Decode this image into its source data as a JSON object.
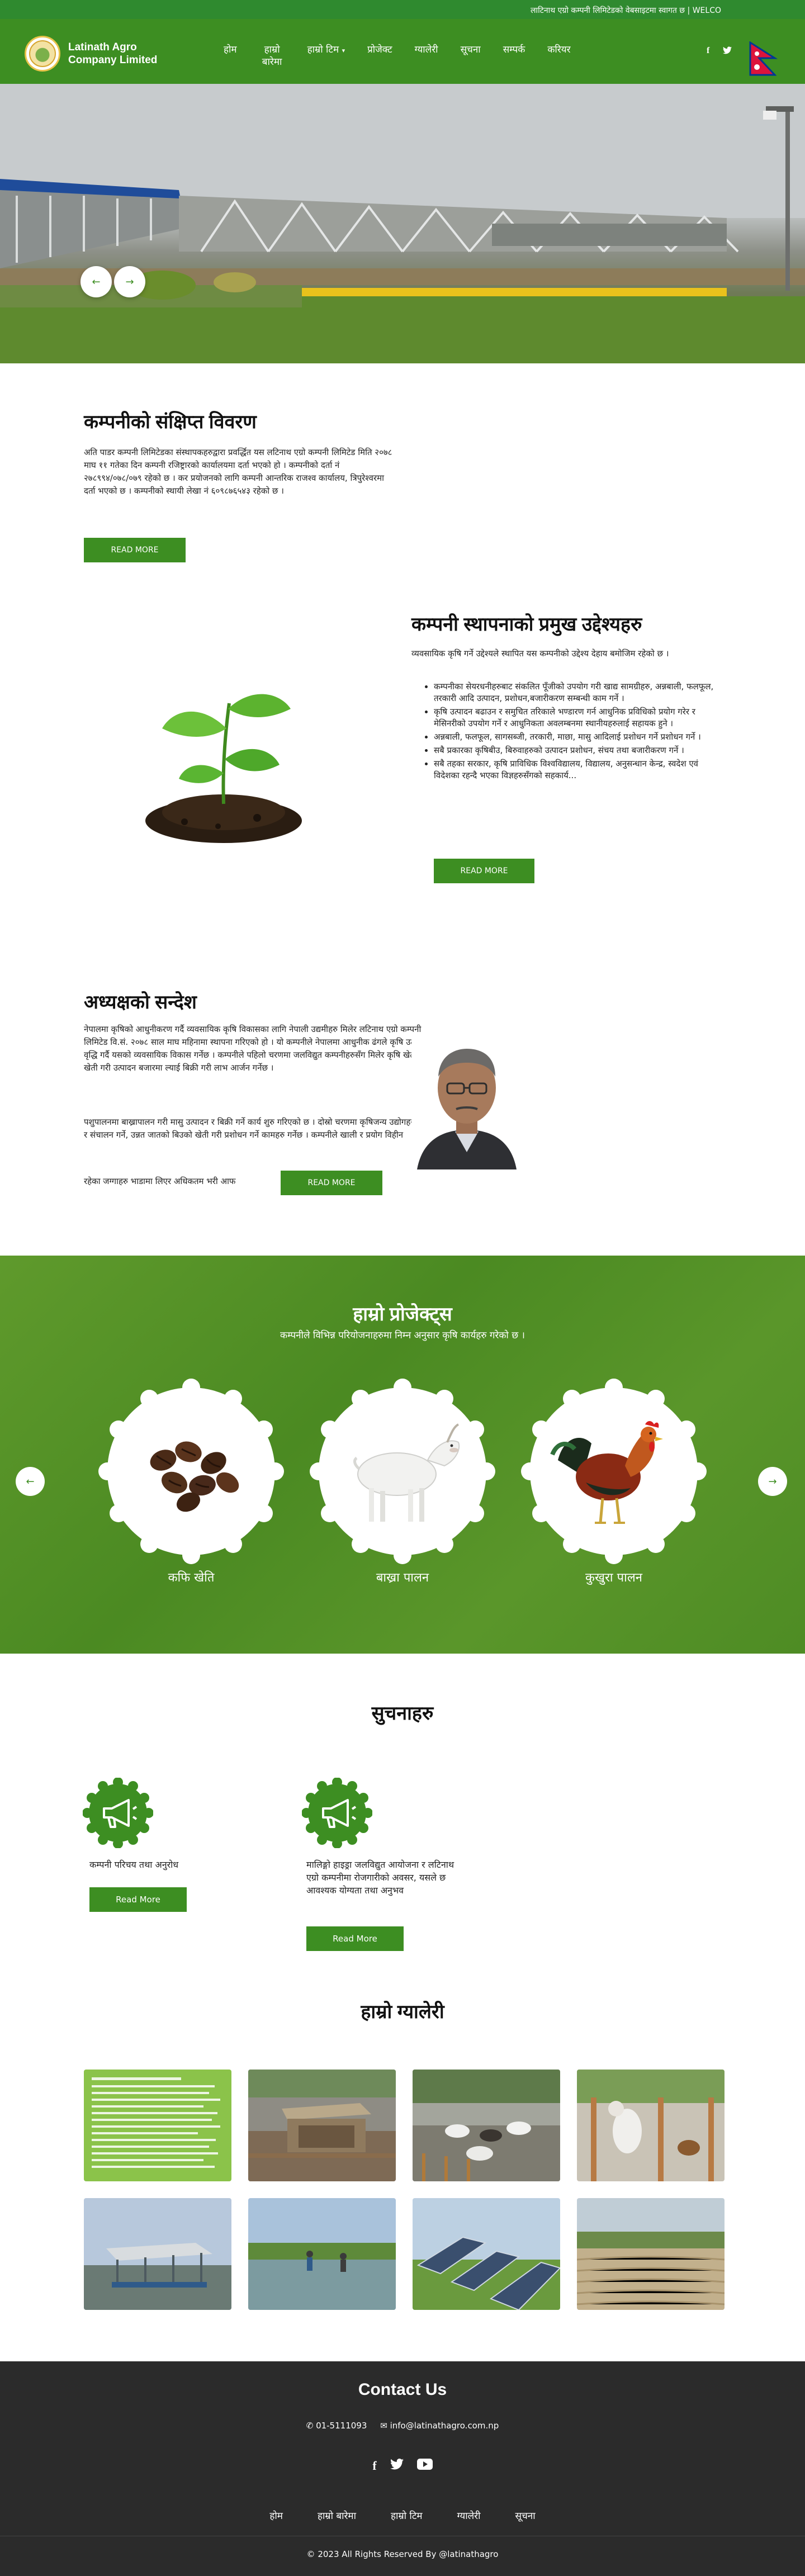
{
  "topbar": {
    "marquee_text": "लाटिनाथ एग्रो कम्पनी लिमिटेडको वेबसाइटमा स्वागत छ | WELCO"
  },
  "header": {
    "logo_line1": "Latinath Agro",
    "logo_line2": "Company Limited",
    "nav": [
      {
        "label": "होम"
      },
      {
        "label": "हाम्रो बारेमा"
      },
      {
        "label": "हाम्रो टिम"
      },
      {
        "label": "प्रोजेक्ट"
      },
      {
        "label": "ग्यालेरी"
      },
      {
        "label": "सूचना"
      },
      {
        "label": "सम्पर्क"
      },
      {
        "label": "करियर"
      }
    ],
    "social_icons": [
      "facebook-icon",
      "twitter-icon"
    ]
  },
  "hero": {
    "prev_icon": "arrow-left-icon",
    "next_icon": "arrow-right-icon"
  },
  "about": {
    "title": "कम्पनीको संक्षिप्त विवरण",
    "text": "अति पाडर कम्पनी लिमिटेडका संस्थापकहरुद्वारा प्रवर्द्धित यस लटिनाथ एग्रो कम्पनी लिमिटेड मिति २०७८ माघ ११ गतेका दिन कम्पनी रजिष्ट्रारको कार्यालयमा दर्ता भएको हो । कम्पनीको दर्ता नं २७८९९४/०७८/०७९ रहेको छ । कर प्रयोजनको लागि कम्पनी आन्तरिक राजश्व कार्यालय, त्रिपुरेश्वरमा दर्ता भएको छ । कम्पनीको स्थायी लेखा नं ६०९८७६५४३ रहेको छ ।",
    "button": "READ MORE"
  },
  "objectives": {
    "title": "कम्पनी स्थापनाको प्रमुख उद्देश्यहरु",
    "intro": "व्यवसायिक कृषि गर्ने उद्देश्यले स्थापित यस कम्पनीको उद्देश्य देहाय बमोजिम रहेको छ ।",
    "items": [
      "कम्पनीका सेयरधनीहरुबाट संकलित पूँजीको उपयोग गरी खाद्य सामग्रीहरु, अन्नबाली, फलफूल, तरकारी आदि उत्पादन, प्रशोधन,बजारीकरण सम्बन्धी काम गर्ने ।",
      "कृषि उत्पादन बढाउन र समुचित तरिकाले भण्डारण गर्न आधुनिक प्रविधिको प्रयोग गरेर र मेसिनरीको उपयोग गर्ने र आधुनिकता अवलम्बनमा स्थानीयहरुलाई सहायक हुने ।",
      "अन्नबाली, फलफूल, सागसब्जी, तरकारी, माछा, मासु आदिलाई प्रशोधन गर्ने प्रशोधन गर्ने ।",
      "सबै प्रकारका कृषिबीउ, बिरुवाहरुको उत्पादन प्रशोधन, संचय तथा बजारीकरण गर्ने ।",
      "सबै तहका सरकार, कृषि प्राविधिक विश्वविद्यालय, विद्यालय, अनुसन्धान केन्द्र, स्वदेश एवं विदेशका रहन्दै भएका विज्ञहरुसँगको सहकार्य..."
    ],
    "button": "READ MORE"
  },
  "chairman": {
    "title": "अध्यक्षको सन्देश",
    "text1": "नेपालमा कृषिको आधुनीकरण गर्दै व्यवसायिक कृषि विकासका लागि नेपाली उद्यमीहरु मिलेर लटिनाथ एग्रो कम्पनी लिमिटेड वि.सं. २०७८ साल माघ महिनामा स्थापना गरिएको हो । यो कम्पनीले नेपालमा आधुनीक ढंगले कृषि उत्पादन वृद्धि गर्दै यसको व्यवसायिक विकास गर्नेछ । कम्पनीले पहिलो चरणमा जलविद्युत कम्पनीहरुसँग मिलेर कृषि खेती, नर्सरी खेती गरी उत्पादन बजारमा ल्याई बिक्री गरी लाभ आर्जन गर्नेछ ।",
    "text2": "पशुपालनमा बाख्रापालन गरी मासु उत्पादन र बिक्री गर्ने कार्य शुरु गरिएको छ । दोस्रो चरणमा कृषिजन्य उद्योगहरु स्थापना र संचालन गर्ने, उन्नत जातको बिउको खेती गरी प्रशोधन गर्ने कामहरु गर्नेछ । कम्पनीले खाली र प्रयोग विहीन",
    "text3": "रहेका जग्गाहरु भाडामा लिएर अधिकतम भरी आफ",
    "button": "READ MORE"
  },
  "projects": {
    "title": "हाम्रो प्रोजेक्ट्स",
    "subtitle": "कम्पनीले विभिन्न परियोजनाहरुमा निम्न अनुसार कृषि कार्यहरु गरेको छ ।",
    "items": [
      {
        "label": "कफि खेति",
        "image": "coffee-beans-image"
      },
      {
        "label": "बाख्रा पालन",
        "image": "goat-image"
      },
      {
        "label": "कुखुरा पालन",
        "image": "rooster-image"
      }
    ]
  },
  "notices": {
    "title": "सुचनाहरु",
    "items": [
      {
        "text": "कम्पनी परिचय तथा अनुरोध",
        "button": "Read More"
      },
      {
        "text": "मालिङ्गो हाइड्रा जलविद्युत आयोजना र लटिनाथ एग्रो कम्पनीमा रोजगारीको अवसर, यसले छ आवश्यक योग्यता तथा अनुभव",
        "button": "Read More"
      }
    ]
  },
  "gallery": {
    "title": "हाम्रो ग्यालेरी",
    "images": [
      "notice-document-image",
      "animal-shed-image",
      "goats-image",
      "goat-pen-image",
      "pond-structure-image",
      "fish-pond-image",
      "solar-panels-image",
      "farmland-image"
    ]
  },
  "footer": {
    "title": "Contact Us",
    "phone": "01-5111093",
    "email": "info@latinathagro.com.np",
    "social": [
      "facebook-icon",
      "twitter-icon",
      "youtube-icon"
    ],
    "nav": [
      "होम",
      "हाम्रो बारेमा",
      "हाम्रो टिम",
      "ग्यालेरी",
      "सूचना"
    ],
    "copyright": "© 2023 All Rights Reserved By @latinathagro"
  },
  "colors": {
    "brand_green": "#3d8e22",
    "topbar_green": "#2f8a2f",
    "footer_dark": "#2b2b2b"
  }
}
